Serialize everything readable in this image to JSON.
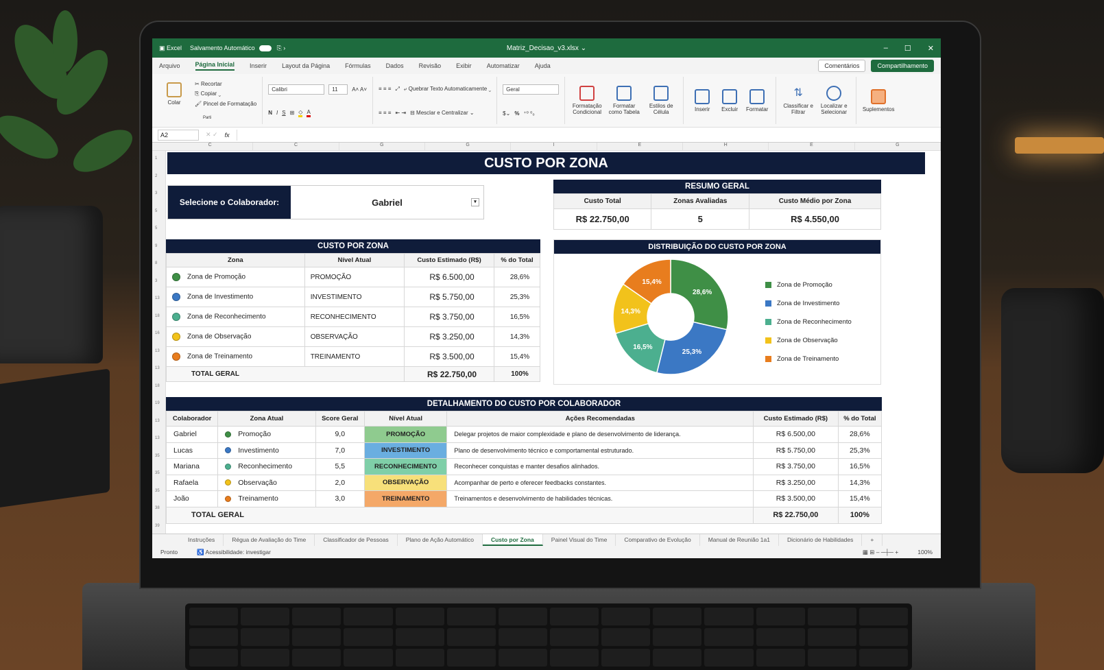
{
  "app": {
    "name": "Excel",
    "autosave": "Salvamento Automático",
    "filename": "Matriz_Decisao_v3.xlsx ⌄"
  },
  "menu": {
    "items": [
      "Arquivo",
      "Página Inicial",
      "Inserir",
      "Layout da Página",
      "Fórmulas",
      "Dados",
      "Revisão",
      "Exibir",
      "Automatizar",
      "Ajuda"
    ],
    "comments": "Comentários",
    "share": "Compartilhamento"
  },
  "ribbon": {
    "paste": "Colar",
    "cut": "Recortar",
    "copy": "Copiar",
    "format_painter": "Pincel de Formatação",
    "clipboard": "Parti",
    "font": "Calibri",
    "size": "11",
    "bold": "N",
    "italic": "I",
    "underline": "S",
    "wrap": "Quebrar Texto Automaticamente",
    "merge": "Mesclar e Centralizar",
    "numfmt": "Geral",
    "cond": "Formatação Condicional",
    "table": "Formatar como Tabela",
    "styles": "Estilos de Célula",
    "insert": "Inserir",
    "delete": "Excluir",
    "format": "Formatar",
    "sort": "Classificar e Filtrar",
    "find": "Localizar e Selecionar",
    "addins": "Suplementos"
  },
  "formula": {
    "cell": "A2",
    "fx": "fx"
  },
  "columns": [
    "C",
    "C",
    "G",
    "G",
    "I",
    "E",
    "H",
    "E",
    "G"
  ],
  "rows": [
    "1",
    "2",
    "3",
    "5",
    "5",
    "9",
    "8",
    "3",
    "13",
    "18",
    "16",
    "13",
    "13",
    "18",
    "19",
    "13",
    "13",
    "35",
    "35",
    "35",
    "38",
    "39"
  ],
  "title": "CUSTO POR ZONA",
  "selector": {
    "label": "Selecione o Colaborador:",
    "value": "Gabriel"
  },
  "resumo": {
    "title": "RESUMO GERAL",
    "headers": [
      "Custo Total",
      "Zonas Avaliadas",
      "Custo Médio por Zona"
    ],
    "values": [
      "R$ 22.750,00",
      "5",
      "R$ 4.550,00"
    ]
  },
  "cpz": {
    "title": "CUSTO POR ZONA",
    "headers": [
      "Zona",
      "Nível Atual",
      "Custo Estimado (R$)",
      "% do Total"
    ],
    "rows": [
      {
        "zona": "Zona de Promoção",
        "nivel": "PROMOÇÃO",
        "custo": "R$ 6.500,00",
        "pct": "28,6%",
        "color": "#3f8f46"
      },
      {
        "zona": "Zona de Investimento",
        "nivel": "INVESTIMENTO",
        "custo": "R$ 5.750,00",
        "pct": "25,3%",
        "color": "#3b78c4"
      },
      {
        "zona": "Zona de Reconhecimento",
        "nivel": "RECONHECIMENTO",
        "custo": "R$ 3.750,00",
        "pct": "16,5%",
        "color": "#4caf8f"
      },
      {
        "zona": "Zona de Observação",
        "nivel": "OBSERVAÇÃO",
        "custo": "R$ 3.250,00",
        "pct": "14,3%",
        "color": "#f2c21b"
      },
      {
        "zona": "Zona de Treinamento",
        "nivel": "TREINAMENTO",
        "custo": "R$ 3.500,00",
        "pct": "15,4%",
        "color": "#e87d1e"
      }
    ],
    "total": {
      "label": "TOTAL GERAL",
      "custo": "R$ 22.750,00",
      "pct": "100%"
    }
  },
  "chart_data": {
    "type": "pie",
    "title": "DISTRIBUIÇÃO DO CUSTO POR ZONA",
    "categories": [
      "Zona de Promoção",
      "Zona de Investimento",
      "Zona de Reconhecimento",
      "Zona de Observação",
      "Zona de Treinamento"
    ],
    "values": [
      28.6,
      25.3,
      16.5,
      14.3,
      15.4
    ],
    "labels": [
      "28,6%",
      "25,3%",
      "16,5%",
      "14,3%",
      "15,4%"
    ],
    "colors": [
      "#3f8f46",
      "#3b78c4",
      "#4caf8f",
      "#f2c21b",
      "#e87d1e"
    ],
    "legend": "right",
    "donut": true
  },
  "det": {
    "title": "DETALHAMENTO DO CUSTO POR COLABORADOR",
    "headers": [
      "Colaborador",
      "Zona Atual",
      "Score Geral",
      "Nível Atual",
      "Ações Recomendadas",
      "Custo Estimado (R$)",
      "% do Total"
    ],
    "rows": [
      {
        "nome": "Gabriel",
        "zona": "Promoção",
        "score": "9,0",
        "nivel": "PROMOÇÃO",
        "acao": "Delegar projetos de maior complexidade e plano de desenvolvimento de liderança.",
        "custo": "R$ 6.500,00",
        "pct": "28,6%",
        "color": "#3f8f46",
        "bg": "#8fcb8f"
      },
      {
        "nome": "Lucas",
        "zona": "Investimento",
        "score": "7,0",
        "nivel": "INVESTIMENTO",
        "acao": "Plano de desenvolvimento técnico e comportamental estruturado.",
        "custo": "R$ 5.750,00",
        "pct": "25,3%",
        "color": "#3b78c4",
        "bg": "#6aaee0"
      },
      {
        "nome": "Mariana",
        "zona": "Reconhecimento",
        "score": "5,5",
        "nivel": "RECONHECIMENTO",
        "acao": "Reconhecer conquistas e manter desafios alinhados.",
        "custo": "R$ 3.750,00",
        "pct": "16,5%",
        "color": "#4caf8f",
        "bg": "#7fcfa8"
      },
      {
        "nome": "Rafaela",
        "zona": "Observação",
        "score": "2,0",
        "nivel": "OBSERVAÇÃO",
        "acao": "Acompanhar de perto e oferecer feedbacks constantes.",
        "custo": "R$ 3.250,00",
        "pct": "14,3%",
        "color": "#f2c21b",
        "bg": "#f7e07a"
      },
      {
        "nome": "João",
        "zona": "Treinamento",
        "score": "3,0",
        "nivel": "TREINAMENTO",
        "acao": "Treinamentos e desenvolvimento de habilidades técnicas.",
        "custo": "R$ 3.500,00",
        "pct": "15,4%",
        "color": "#e87d1e",
        "bg": "#f4a868"
      }
    ],
    "total": {
      "label": "TOTAL GERAL",
      "custo": "R$ 22.750,00",
      "pct": "100%"
    }
  },
  "sheets": [
    "Instruções",
    "Régua de Avaliação do Time",
    "Classificador de Pessoas",
    "Plano de Ação Automático",
    "Custo por Zona",
    "Painel Visual do Time",
    "Comparativo de Evolução",
    "Manual de Reunião 1a1",
    "Dicionário de Habilidades"
  ],
  "status": {
    "ready": "Pronto",
    "access": "Acessibilidade: investigar",
    "zoom": "100%"
  }
}
